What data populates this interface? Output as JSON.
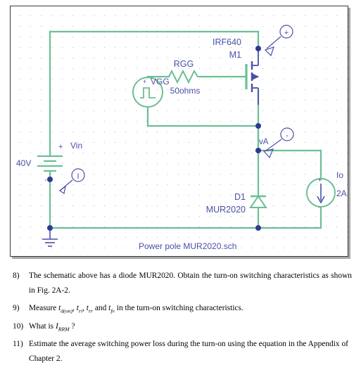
{
  "schematic": {
    "title": "Power pole MUR2020.sch",
    "colors": {
      "wire": "#6cbf96",
      "symbol": "#4a4fa8",
      "node": "#2f3a8f",
      "grid_dot": "#b9b9c4",
      "frame_border": "#3a3a3a",
      "background": "#ffffff"
    },
    "labels": {
      "vin_name": "Vin",
      "vin_value": "40V",
      "vin_plus": "+",
      "vin_minus": "-",
      "current_probe": "I",
      "vgg_name": "VGG",
      "vgg_plus": "+",
      "rgg_name": "RGG",
      "rgg_value": "50ohms",
      "mosfet_part": "IRF640",
      "mosfet_ref": "M1",
      "drain_probe": "+",
      "node_probe_name": "vA",
      "node_probe_sign": "-",
      "diode_ref": "D1",
      "diode_part": "MUR2020",
      "load_name": "Io",
      "load_value": "2A",
      "load_plus": "+",
      "load_minus": "-"
    }
  },
  "questions": [
    {
      "number": "8)",
      "text": "The schematic above has a diode MUR2020.  Obtain the turn-on switching characteristics as shown in Fig. 2A-2."
    },
    {
      "number": "9)",
      "text_before": "Measure ",
      "sym1": "t",
      "sub1": "d(on)",
      "sep1": ", ",
      "sym2": "t",
      "sub2": "ri",
      "sep2": ", ",
      "sym3": "t",
      "sub3": "rr",
      "sep3": " and ",
      "sym4": "t",
      "sub4": "fv",
      "text_after": " in the turn-on switching characteristics."
    },
    {
      "number": "10)",
      "text_before": "What is ",
      "sym1": "I",
      "sub1": "RRM",
      "text_after": " ?"
    },
    {
      "number": "11)",
      "text": "Estimate the average switching power loss during the turn-on using the equation in the Appendix of Chapter 2."
    }
  ]
}
